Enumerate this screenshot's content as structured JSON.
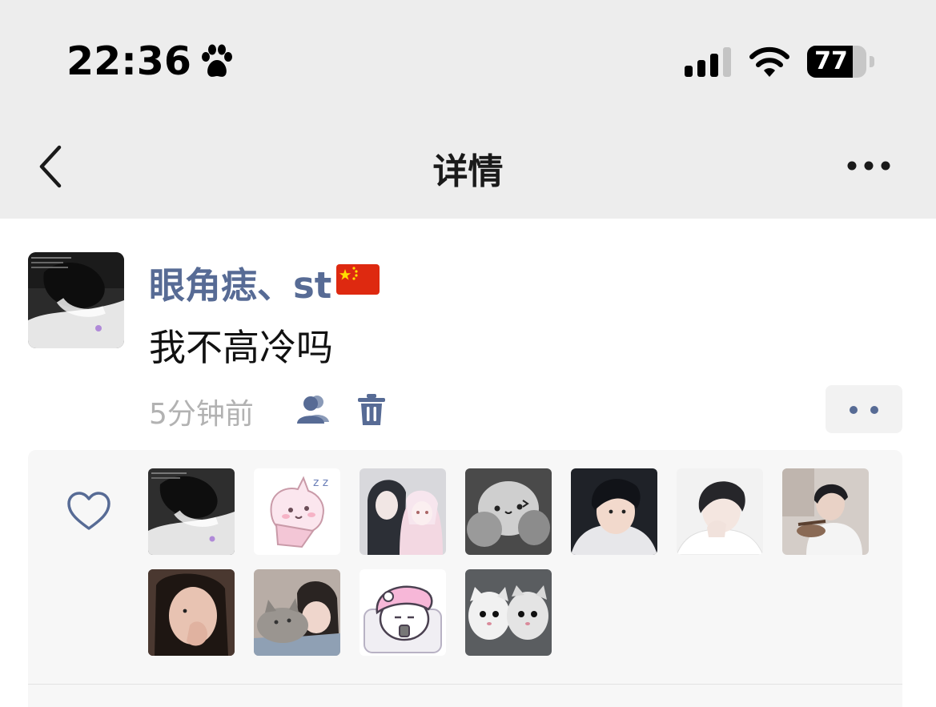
{
  "status_bar": {
    "time": "22:36",
    "battery": "77",
    "battery_level": 0.77
  },
  "nav": {
    "title": "详情"
  },
  "post": {
    "author": "眼角痣、st",
    "content": "我不高冷吗",
    "time_ago": "5分钟前"
  },
  "likes": {
    "count": 11,
    "avatars": [
      "liker-1",
      "liker-2",
      "liker-3",
      "liker-4",
      "liker-5",
      "liker-6",
      "liker-7",
      "liker-8",
      "liker-9",
      "liker-10",
      "liker-11"
    ]
  },
  "colors": {
    "link_blue": "#576b95",
    "top_bar_bg": "#ededed",
    "likes_bg": "#f7f7f7"
  },
  "icons": [
    "paw-icon",
    "signal-icon",
    "wifi-icon",
    "battery-icon",
    "back-icon",
    "more-icon",
    "group-icon",
    "trash-icon",
    "heart-icon",
    "china-flag-icon"
  ]
}
